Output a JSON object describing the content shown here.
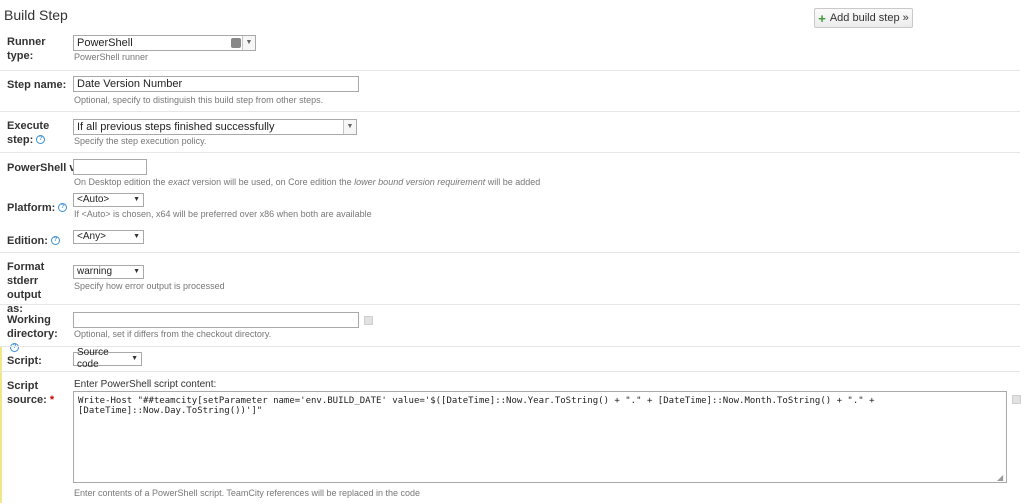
{
  "page": {
    "title": "Build Step",
    "add_button": "Add build step »"
  },
  "runner": {
    "label": "Runner type:",
    "value": "PowerShell",
    "note": "PowerShell runner"
  },
  "step_name": {
    "label": "Step name:",
    "value": "Date Version Number",
    "note": "Optional, specify to distinguish this build step from other steps."
  },
  "execute": {
    "label": "Execute step:",
    "value": "If all previous steps finished successfully",
    "note": "Specify the step execution policy."
  },
  "ps_version": {
    "label": "PowerShell ver",
    "note_a": "On Desktop edition the ",
    "note_b": "exact",
    "note_c": " version will be used, on Core edition the ",
    "note_d": "lower bound version requirement",
    "note_e": " will be added"
  },
  "platform": {
    "label": "Platform:",
    "value": "<Auto>",
    "note": "If <Auto> is chosen, x64 will be preferred over x86 when both are available"
  },
  "edition": {
    "label": "Edition:",
    "value": "<Any>"
  },
  "stderr": {
    "label": "Format stderr output as:",
    "value": "warning",
    "note": "Specify how error output is processed"
  },
  "workdir": {
    "label": "Working directory:",
    "value": "",
    "note": "Optional, set if differs from the checkout directory."
  },
  "script": {
    "label": "Script:",
    "value": "Source code"
  },
  "script_source": {
    "label": "Script source:",
    "required": "*",
    "prompt": "Enter PowerShell script content:",
    "value": "Write-Host \"##teamcity[setParameter name='env.BUILD_DATE' value='$([DateTime]::Now.Year.ToString() + \".\" + [DateTime]::Now.Month.ToString() + \".\" + [DateTime]::Now.Day.ToString())']\"",
    "note": "Enter contents of a PowerShell script. TeamCity references will be replaced in the code"
  }
}
